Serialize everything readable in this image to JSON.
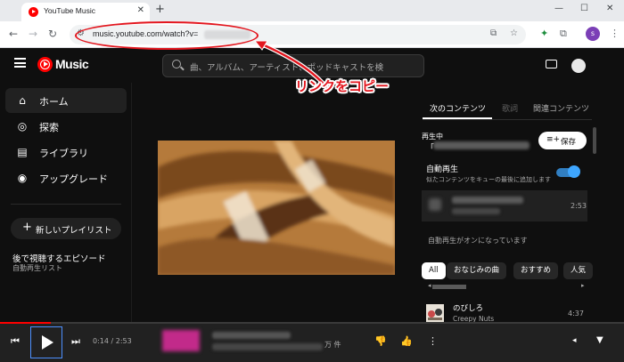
{
  "browser": {
    "tab_title": "YouTube Music",
    "tab_close": "✕",
    "new_tab": "+",
    "url": "music.youtube.com/watch?v=",
    "window_controls": {
      "minimize": "—",
      "maximize": "☐",
      "close": "✕"
    },
    "nav": {
      "back": "←",
      "forward": "→",
      "reload": "↻"
    },
    "icons": {
      "site_info": "⚙",
      "screenshot": "⧉",
      "bookmark": "☆",
      "extension_green": "✦",
      "extensions": "⧉",
      "profile_initial": "s",
      "menu": "⋮"
    }
  },
  "app": {
    "logo_text": "Music",
    "search_placeholder": "曲、アルバム、アーティスト、ポッドキャストを検"
  },
  "sidebar": {
    "items": [
      {
        "label": "ホーム",
        "icon": "⌂"
      },
      {
        "label": "探索",
        "icon": "◎"
      },
      {
        "label": "ライブラリ",
        "icon": "▤"
      },
      {
        "label": "アップグレード",
        "icon": "◉"
      }
    ],
    "new_playlist_plus": "+",
    "new_playlist_label": "新しいプレイリスト",
    "playlist_title": "後で視聴するエピソード",
    "playlist_subtitle": "自動再生リスト"
  },
  "annotation": {
    "label": "リンクをコピー",
    "color": "#e3161e"
  },
  "right_panel": {
    "tabs": [
      "次のコンテンツ",
      "歌詞",
      "関連コンテンツ"
    ],
    "now_playing_label": "再生中",
    "now_playing_quote": "「",
    "save_icon": "≡+",
    "save_label": "保存",
    "autoplay_label": "自動再生",
    "autoplay_desc": "似たコンテンツをキューの最後に追加します",
    "autoplay_on": true,
    "queue_item_time": "2:53",
    "autoplay_on_text": "自動再生がオンになっています",
    "chips": [
      "All",
      "おなじみの曲",
      "おすすめ",
      "人気"
    ],
    "chip_scroll_left": "◂",
    "chip_scroll_right": "▸",
    "recommendation": {
      "title": "のびしろ",
      "artist": "Creepy Nuts",
      "time": "4:37"
    }
  },
  "player": {
    "prev_icon": "⏮",
    "next_icon": "⏭",
    "time": "0:14 / 2:53",
    "progress": 0.081,
    "views_suffix": "万 件",
    "dislike_icon": "👎",
    "like_icon": "👍",
    "more_icon": "⋮",
    "volume_icon": "◂",
    "expand_icon": "▼"
  },
  "colors": {
    "accent_red": "#ff0000",
    "toggle_blue": "#3ea6ff",
    "background": "#0f0f0f"
  }
}
